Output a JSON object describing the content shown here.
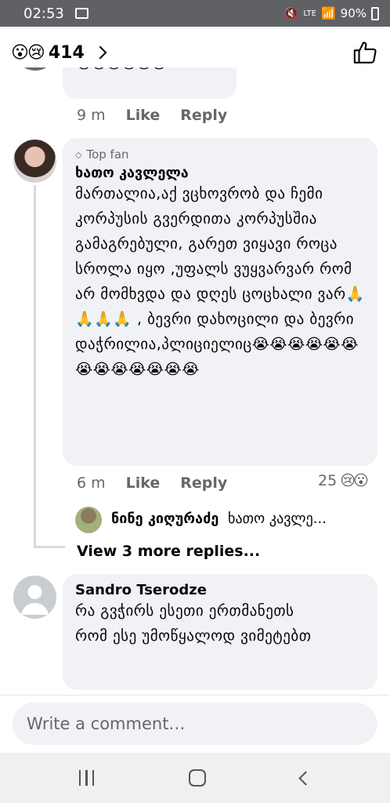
{
  "status_bar": {
    "time": "02:53",
    "network": "LTE",
    "battery": "90%"
  },
  "header": {
    "reaction_emojis": "😮😢",
    "reaction_count": "414"
  },
  "comments": [
    {
      "emoji_line": "😭😭😭😭😭😭",
      "time": "9 m",
      "like": "Like",
      "reply": "Reply"
    },
    {
      "badge": "Top fan",
      "author": "ხათო კავლელა",
      "text": "მართალია,აქ ვცხოვრობ და ჩემი კორპუსის გვერდითა კორპუსშია გამაგრებული, გარეთ ვიყავი როცა სროლა იყო ,უფალს ვუყვარვარ რომ არ მომხვდა და დღეს ცოცხალი ვარ🙏🙏🙏🙏 , ბევრი დახოცილი და ბევრი დაჭრილია,პლიციელიც😭😭😭😭😭😭😭😭😭😭😭😭😭",
      "time": "6 m",
      "like": "Like",
      "reply": "Reply",
      "reaction_count": "25",
      "reaction_emojis": "😢😮",
      "reply_preview": {
        "author": "ნინე კიღურაძე",
        "text": "ხათო კავლე..."
      },
      "more_replies": "View 3 more replies..."
    },
    {
      "author": "Sandro Tserodze",
      "text": "რა გვჭირს ესეთი ერთმანეთს რომ ესე უმოწყალოდ ვიმეტებთ"
    }
  ],
  "composer": {
    "placeholder": "Write a comment…"
  },
  "colors": {
    "bubble": "#f0f2f5",
    "meta": "#65676b",
    "status_bar": "#5f6165"
  }
}
